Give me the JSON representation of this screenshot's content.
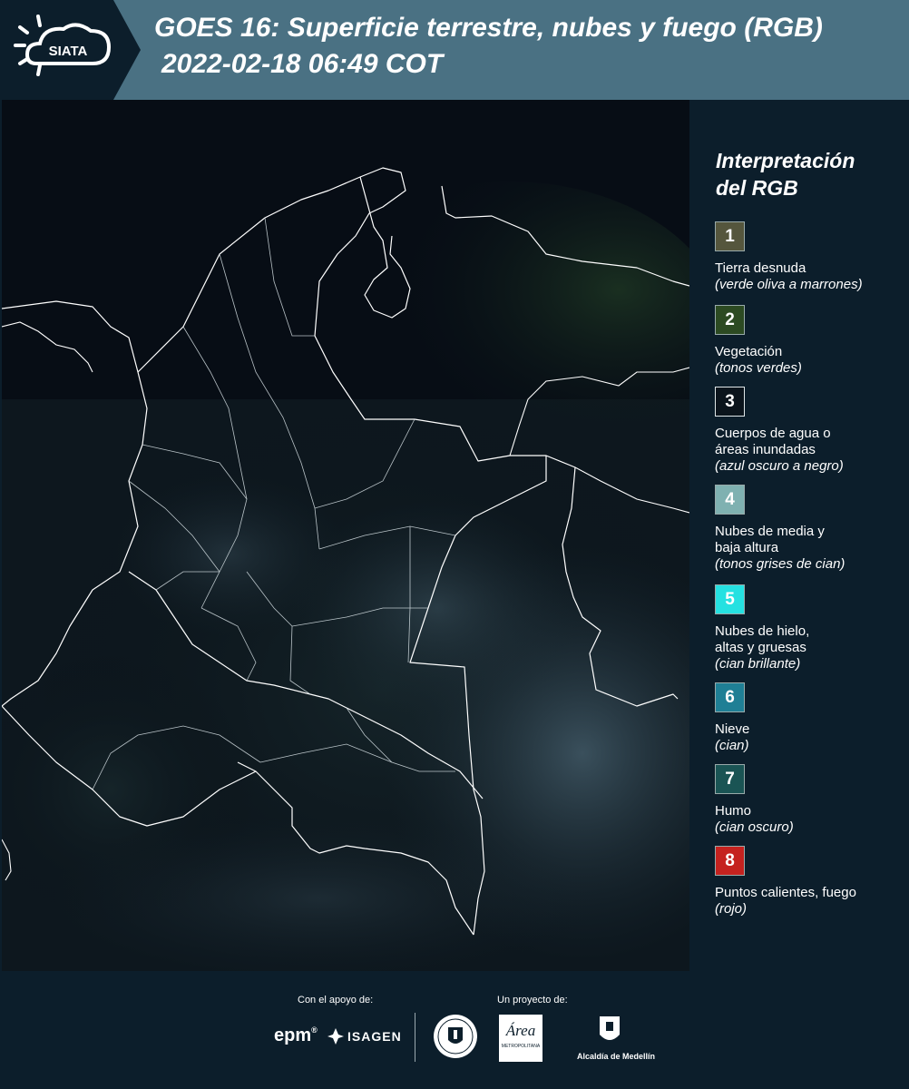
{
  "header": {
    "logo_text": "SIATA",
    "title_line1": "GOES 16: Superficie terrestre, nubes y fuego (RGB)",
    "title_line2": "2022-02-18 06:49 COT"
  },
  "legend": {
    "title_line1": "Interpretación",
    "title_line2": "del RGB",
    "items": [
      {
        "num": "1",
        "color": "#55563d",
        "label": "Tierra desnuda",
        "note": "(verde oliva a marrones)"
      },
      {
        "num": "2",
        "color": "#2c4a22",
        "label": "Vegetación",
        "note": "(tonos verdes)"
      },
      {
        "num": "3",
        "color": "#0b141c",
        "label": "Cuerpos de agua o",
        "label2": "áreas inundadas",
        "note": "(azul oscuro a negro)"
      },
      {
        "num": "4",
        "color": "#7fb1b1",
        "label": "Nubes de media y",
        "label2": "baja altura",
        "note": "(tonos grises de cian)"
      },
      {
        "num": "5",
        "color": "#25e1e1",
        "label": "Nubes de hielo,",
        "label2": "altas y gruesas",
        "note": "(cian brillante)"
      },
      {
        "num": "6",
        "color": "#1f7f95",
        "label": "Nieve",
        "note": "(cian)"
      },
      {
        "num": "7",
        "color": "#1a5454",
        "label": "Humo",
        "note": "(cian oscuro)"
      },
      {
        "num": "8",
        "color": "#c5221f",
        "label": "Puntos calientes, fuego",
        "note": "(rojo)"
      }
    ]
  },
  "footer": {
    "support_label": "Con el apoyo de:",
    "project_label": "Un proyecto de:",
    "epm": "epm",
    "isagen": "ISAGEN",
    "area_logo_text": "Área",
    "area_sub": "METROPOLITANA",
    "alcaldia": "Alcaldía de Medellín"
  }
}
